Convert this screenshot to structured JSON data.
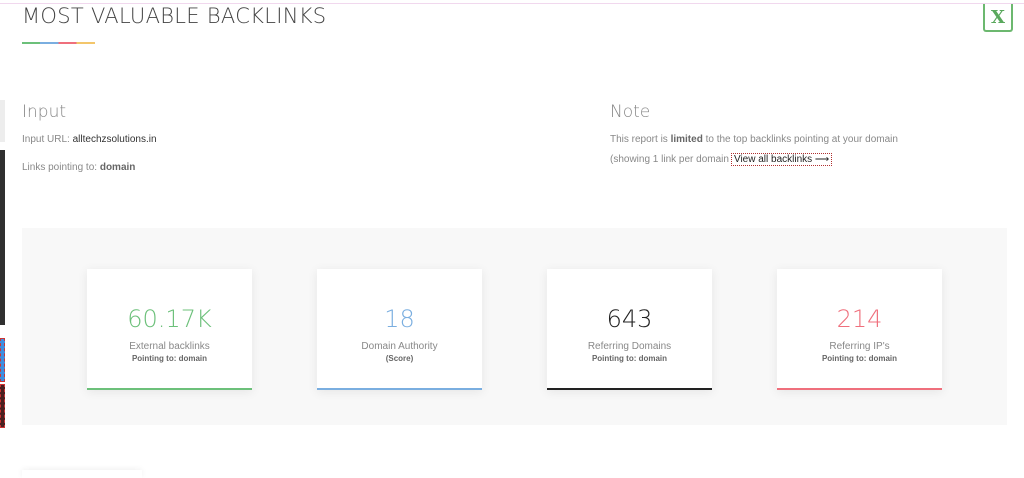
{
  "header": {
    "title": "MOST VALUABLE BACKLINKS",
    "excel_glyph": "X"
  },
  "input_section": {
    "heading": "Input",
    "url_label": "Input URL:",
    "url_value": "alltechzsolutions.in",
    "links_label": "Links pointing to:",
    "links_value": "domain"
  },
  "note_section": {
    "heading": "Note",
    "line1_pre": "This report is",
    "line1_bold": "limited",
    "line1_post": "to the top backlinks pointing at your domain",
    "line2": "(showing 1 link per domain",
    "view_all_label": "View all backlinks ⟶"
  },
  "stats": [
    {
      "value": "60.17K",
      "label": "External backlinks",
      "sub": "Pointing to: domain",
      "color": "#6cc07a"
    },
    {
      "value": "18",
      "label": "Domain Authority",
      "sub": "(Score)",
      "color": "#7aaee0"
    },
    {
      "value": "643",
      "label": "Referring Domains",
      "sub": "Pointing to: domain",
      "color": "#222222"
    },
    {
      "value": "214",
      "label": "Referring IP's",
      "sub": "Pointing to: domain",
      "color": "#ef6f7c"
    }
  ]
}
